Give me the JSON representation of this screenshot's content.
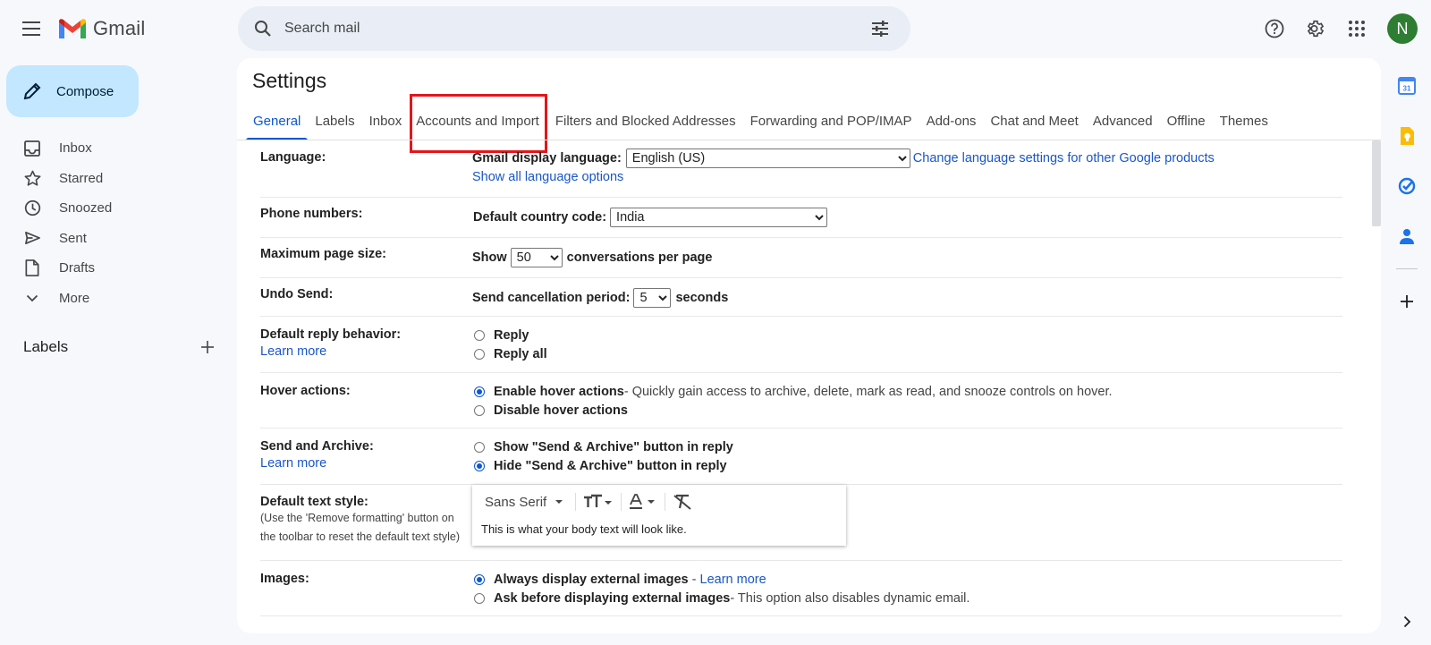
{
  "app": {
    "name": "Gmail",
    "avatar_letter": "N",
    "avatar_color": "#2e7d32"
  },
  "search": {
    "placeholder": "Search mail"
  },
  "compose": {
    "label": "Compose"
  },
  "nav": [
    {
      "label": "Inbox",
      "icon": "inbox-icon"
    },
    {
      "label": "Starred",
      "icon": "star-icon"
    },
    {
      "label": "Snoozed",
      "icon": "clock-icon"
    },
    {
      "label": "Sent",
      "icon": "send-icon"
    },
    {
      "label": "Drafts",
      "icon": "draft-icon"
    },
    {
      "label": "More",
      "icon": "chevron-down-icon"
    }
  ],
  "labels_header": "Labels",
  "settings": {
    "title": "Settings",
    "tabs": [
      "General",
      "Labels",
      "Inbox",
      "Accounts and Import",
      "Filters and Blocked Addresses",
      "Forwarding and POP/IMAP",
      "Add-ons",
      "Chat and Meet",
      "Advanced",
      "Offline",
      "Themes"
    ],
    "active_tab": "General",
    "highlighted_tab": "Accounts and Import"
  },
  "rows": {
    "language": {
      "label": "Language:",
      "display_label": "Gmail display language:",
      "value": "English (US)",
      "change_link": "Change language settings for other Google products",
      "show_all_link": "Show all language options"
    },
    "phone": {
      "label": "Phone numbers:",
      "field_label": "Default country code:",
      "value": "India"
    },
    "page_size": {
      "label": "Maximum page size:",
      "prefix": "Show",
      "value": "50",
      "suffix": "conversations per page"
    },
    "undo_send": {
      "label": "Undo Send:",
      "prefix": "Send cancellation period:",
      "value": "5",
      "suffix": "seconds"
    },
    "reply": {
      "label": "Default reply behavior:",
      "learn_more": "Learn more",
      "opt1": "Reply",
      "opt2": "Reply all"
    },
    "hover": {
      "label": "Hover actions:",
      "opt1": "Enable hover actions",
      "opt1_desc": " - Quickly gain access to archive, delete, mark as read, and snooze controls on hover.",
      "opt2": "Disable hover actions"
    },
    "send_archive": {
      "label": "Send and Archive:",
      "learn_more": "Learn more",
      "opt1": "Show \"Send & Archive\" button in reply",
      "opt2": "Hide \"Send & Archive\" button in reply"
    },
    "text_style": {
      "label": "Default text style:",
      "sub1": "(Use the 'Remove formatting' button on",
      "sub2": "the toolbar to reset the default text style)",
      "font": "Sans Serif",
      "preview": "This is what your body text will look like."
    },
    "images": {
      "label": "Images:",
      "opt1": "Always display external images",
      "opt1_link": "Learn more",
      "opt2": "Ask before displaying external images",
      "opt2_desc": " - This option also disables dynamic email."
    }
  },
  "colors": {
    "accent": "#0b57d0",
    "compose_bg": "#c2e7ff",
    "highlight_box": "#e3161b",
    "link": "#1a56c8"
  }
}
